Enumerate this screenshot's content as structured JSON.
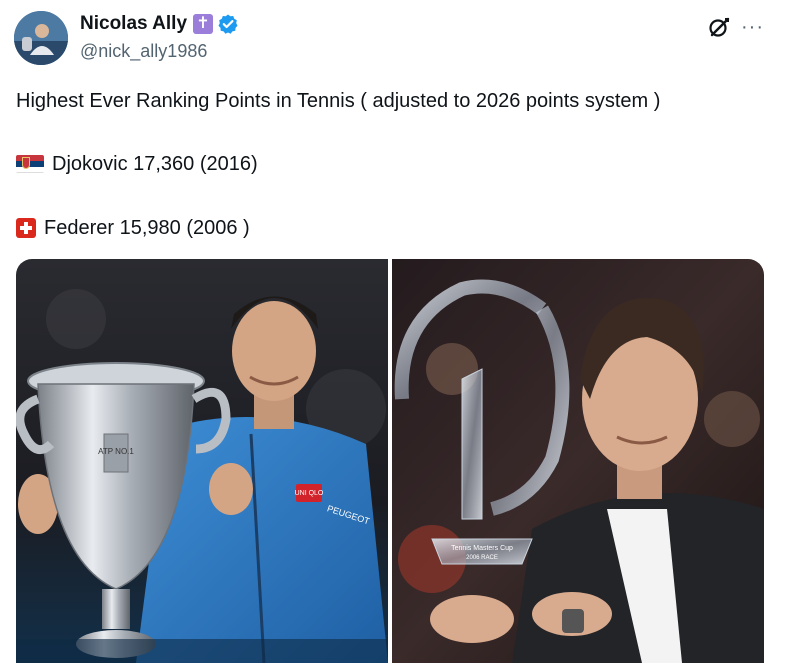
{
  "author": {
    "display_name": "Nicolas Ally",
    "badge_symbol": "✝",
    "handle": "@nick_ally1986"
  },
  "post": {
    "line1": "Highest Ever Ranking Points in Tennis ( adjusted to 2026 points system )",
    "line2": "Djokovic 17,360 (2016)",
    "line3": "Federer 15,980 (2006 )"
  },
  "actions": {
    "more_glyph": "···"
  },
  "media": {
    "left_trophy_text": "ATP NO.1",
    "left_jacket_logo": "UNI QLO",
    "left_sponsor": "PEUGEOT",
    "right_trophy_text": "Tennis Masters Cup",
    "right_trophy_sub": "2006 RACE"
  },
  "colors": {
    "accent_blue": "#1d9bf0",
    "badge_purple": "#9b7ed9",
    "secondary_text": "#536471",
    "serbia_red": "#c6363c",
    "serbia_blue": "#0c4076",
    "swiss_red": "#da291c"
  },
  "icons": {
    "verified": "verified-check-icon",
    "grok": "grok-slash-circle-icon",
    "more": "more-dots-icon"
  }
}
